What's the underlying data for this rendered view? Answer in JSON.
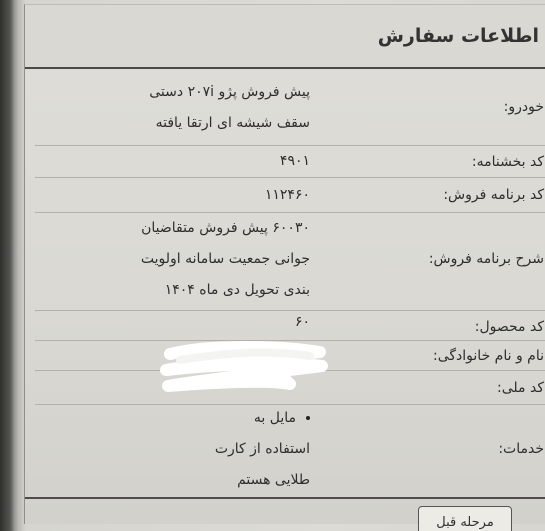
{
  "panel": {
    "title": "اطلاعات سفارش"
  },
  "fields": [
    {
      "label": "خودرو:",
      "lines": [
        "پیش فروش پژو ۲۰۷i دستی",
        "سقف شیشه ای ارتقا یافته"
      ]
    },
    {
      "label": "کد بخشنامه:",
      "lines": [
        "۴۹۰۱"
      ]
    },
    {
      "label": "کد برنامه فروش:",
      "lines": [
        "۱۱۲۴۶۰"
      ]
    },
    {
      "label": "شرح برنامه فروش:",
      "lines": [
        "۶۰۰۳۰ پیش فروش متقاضیان",
        "جوانی جمعیت سامانه اولویت",
        "بندی تحویل دی ماه ۱۴۰۴"
      ]
    },
    {
      "label": "کد محصول:",
      "lines": [
        "۶۰"
      ]
    },
    {
      "label": "نام و نام خانوادگی:",
      "lines": []
    },
    {
      "label": "کد ملی:",
      "lines": []
    },
    {
      "label": "خدمات:",
      "bullet_item": "مایل به",
      "lines": [
        "استفاده از کارت",
        "طلایی هستم"
      ]
    }
  ],
  "buttons": {
    "back": "مرحله قبل"
  }
}
